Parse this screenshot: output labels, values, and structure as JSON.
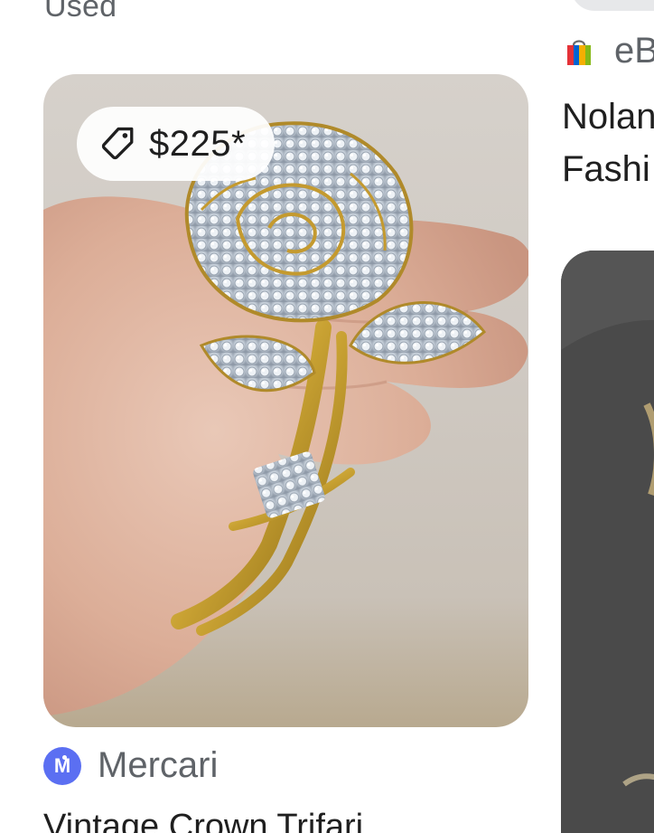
{
  "left_result": {
    "condition": "Used",
    "price": "$225*",
    "source": "Mercari",
    "title": "Vintage Crown Trifari"
  },
  "right_result": {
    "source": "eBay",
    "title_lines": [
      "Nolan",
      "Fashi"
    ]
  },
  "icons": {
    "price_tag": "tag-icon",
    "mercari": "mercari-logo-icon",
    "ebay": "ebay-shopping-bag-icon"
  },
  "colors": {
    "mercari_brand": "#5b6ff2",
    "secondary_text": "#5f6368",
    "primary_text": "#1f1f1f"
  }
}
